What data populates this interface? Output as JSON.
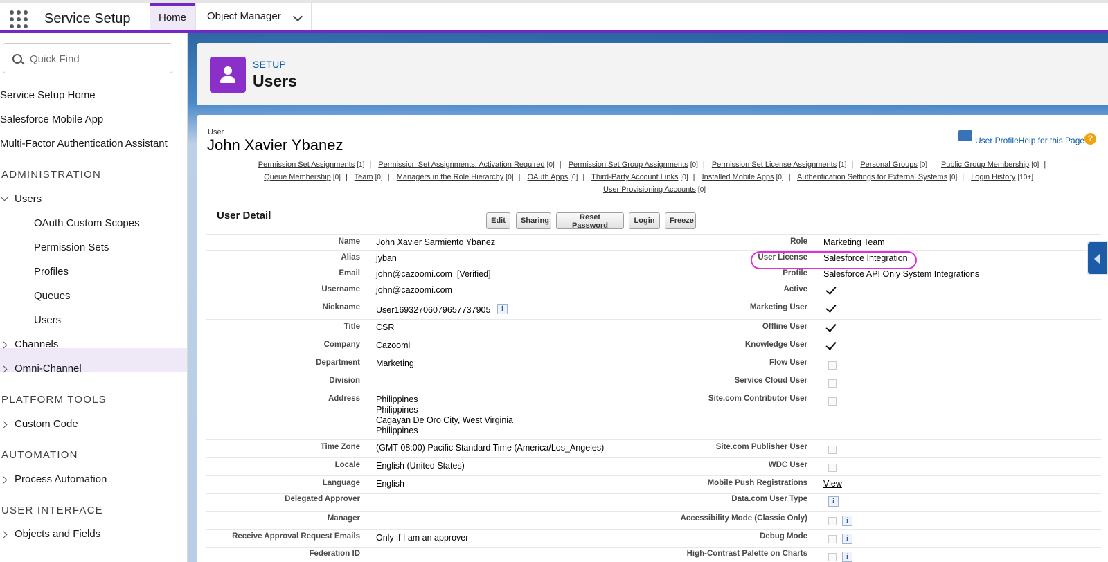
{
  "app": {
    "name": "Service Setup"
  },
  "tabs": [
    {
      "label": "Home"
    },
    {
      "label": "Object Manager"
    }
  ],
  "sidebar": {
    "search_placeholder": "Quick Find",
    "items": [
      {
        "label": "Service Setup Home"
      },
      {
        "label": "Salesforce Mobile App"
      },
      {
        "label": "Multi-Factor Authentication Assistant"
      }
    ],
    "administration": {
      "heading": "ADMINISTRATION",
      "users": "Users",
      "users_children": [
        "OAuth Custom Scopes",
        "Permission Sets",
        "Profiles",
        "Queues",
        "Users"
      ],
      "channels": "Channels",
      "omni": "Omni-Channel"
    },
    "platform_tools": {
      "heading": "PLATFORM TOOLS",
      "custom_code": "Custom Code"
    },
    "automation": {
      "heading": "AUTOMATION",
      "process_automation": "Process Automation"
    },
    "user_interface": {
      "heading": "USER INTERFACE",
      "objects_fields": "Objects and Fields"
    }
  },
  "header": {
    "setup": "SETUP",
    "title": "Users"
  },
  "user": {
    "label": "User",
    "name": "John Xavier Ybanez",
    "help_text": "User ProfileHelp for this Page"
  },
  "related_links": {
    "line1": [
      {
        "label": "Permission Set Assignments",
        "count": "[1]"
      },
      {
        "label": "Permission Set Assignments: Activation Required",
        "count": "[0]"
      },
      {
        "label": "Permission Set Group Assignments",
        "count": "[0]"
      },
      {
        "label": "Permission Set License Assignments",
        "count": "[1]"
      },
      {
        "label": "Personal Groups",
        "count": "[0]"
      },
      {
        "label": "Public Group Membership",
        "count": "[0]"
      }
    ],
    "line2": [
      {
        "label": "Queue Membership",
        "count": "[0]"
      },
      {
        "label": "Team",
        "count": "[0]"
      },
      {
        "label": "Managers in the Role Hierarchy",
        "count": "[0]"
      },
      {
        "label": "OAuth Apps",
        "count": "[0]"
      },
      {
        "label": "Third-Party Account Links",
        "count": "[0]"
      },
      {
        "label": "Installed Mobile Apps",
        "count": "[0]"
      },
      {
        "label": "Authentication Settings for External Systems",
        "count": "[0]"
      },
      {
        "label": "Login History",
        "count": "[10+]"
      }
    ],
    "line3": [
      {
        "label": "User Provisioning Accounts",
        "count": "[0]"
      }
    ]
  },
  "detail": {
    "title": "User Detail",
    "buttons": [
      "Edit",
      "Sharing",
      "Reset Password",
      "Login",
      "Freeze"
    ],
    "left": {
      "name": {
        "label": "Name",
        "value": "John Xavier Sarmiento Ybanez"
      },
      "alias": {
        "label": "Alias",
        "value": "jyban"
      },
      "email": {
        "label": "Email",
        "value": "john@cazoomi.com",
        "suffix": "[Verified]"
      },
      "username": {
        "label": "Username",
        "value": "john@cazoomi.com"
      },
      "nickname": {
        "label": "Nickname",
        "value": "User16932706079657737905"
      },
      "title": {
        "label": "Title",
        "value": "CSR"
      },
      "company": {
        "label": "Company",
        "value": "Cazoomi"
      },
      "department": {
        "label": "Department",
        "value": "Marketing"
      },
      "division": {
        "label": "Division",
        "value": ""
      },
      "address": {
        "label": "Address",
        "lines": [
          "Philippines",
          "Philippines",
          "Cagayan De Oro City, West Virginia",
          "Philippines"
        ]
      },
      "time_zone": {
        "label": "Time Zone",
        "value": "(GMT-08:00) Pacific Standard Time (America/Los_Angeles)"
      },
      "locale": {
        "label": "Locale",
        "value": "English (United States)"
      },
      "language": {
        "label": "Language",
        "value": "English"
      },
      "delegated": {
        "label": "Delegated Approver",
        "value": ""
      },
      "manager": {
        "label": "Manager",
        "value": ""
      },
      "approval": {
        "label": "Receive Approval Request Emails",
        "value": "Only if I am an approver"
      },
      "federation": {
        "label": "Federation ID",
        "value": ""
      }
    },
    "right": {
      "role": {
        "label": "Role",
        "value": "Marketing Team"
      },
      "license": {
        "label": "User License",
        "value": "Salesforce Integration"
      },
      "profile": {
        "label": "Profile",
        "value": "Salesforce API Only System Integrations"
      },
      "active": {
        "label": "Active",
        "checked": true
      },
      "marketing": {
        "label": "Marketing User",
        "checked": true
      },
      "offline": {
        "label": "Offline User",
        "checked": true
      },
      "knowledge": {
        "label": "Knowledge User",
        "checked": true
      },
      "flow": {
        "label": "Flow User",
        "checked": false
      },
      "service_cloud": {
        "label": "Service Cloud User",
        "checked": false
      },
      "site_contrib": {
        "label": "Site.com Contributor User",
        "checked": false
      },
      "site_pub": {
        "label": "Site.com Publisher User",
        "checked": false
      },
      "wdc": {
        "label": "WDC User",
        "checked": false
      },
      "push": {
        "label": "Mobile Push Registrations",
        "value": "View"
      },
      "datacom": {
        "label": "Data.com User Type"
      },
      "accessibility": {
        "label": "Accessibility Mode (Classic Only)",
        "checked": false
      },
      "debug": {
        "label": "Debug Mode",
        "checked": false
      },
      "contrast": {
        "label": "High-Contrast Palette on Charts",
        "checked": false
      }
    }
  },
  "colors": {
    "accent": "#7526c9",
    "link": "#0b5cab",
    "highlight_oval": "#e031d8"
  }
}
